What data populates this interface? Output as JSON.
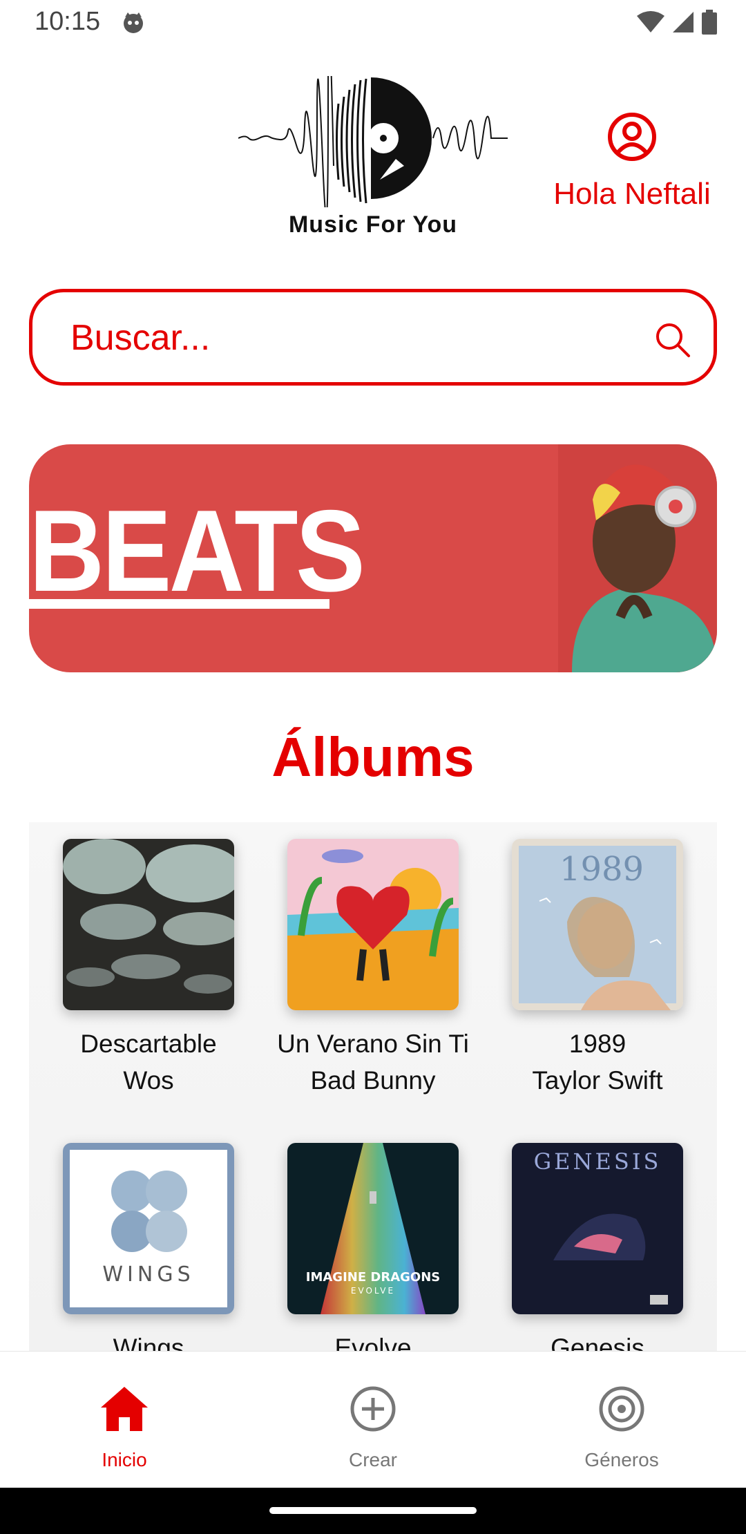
{
  "status_bar": {
    "time": "10:15"
  },
  "header": {
    "logo_text": "Music For You",
    "greeting": "Hola Neftali"
  },
  "search": {
    "placeholder": "Buscar..."
  },
  "banner": {
    "text": "BEATS"
  },
  "section": {
    "title": "Álbums"
  },
  "albums": [
    {
      "title": "Descartable",
      "artist": "Wos"
    },
    {
      "title": "Un Verano Sin Ti",
      "artist": "Bad Bunny"
    },
    {
      "title": "1989",
      "artist": "Taylor Swift"
    },
    {
      "title": "Wings",
      "artist": ""
    },
    {
      "title": "Evolve",
      "artist": ""
    },
    {
      "title": "Genesis",
      "artist": ""
    }
  ],
  "album_cover_text": {
    "wings": "WINGS",
    "evolve_band": "IMAGINE DRAGONS",
    "evolve_title": "EVOLVE",
    "genesis": "GENESIS",
    "taylor": "1989"
  },
  "nav": {
    "items": [
      {
        "label": "Inicio",
        "icon": "home-icon",
        "active": true
      },
      {
        "label": "Crear",
        "icon": "add-circle-icon",
        "active": false
      },
      {
        "label": "Géneros",
        "icon": "target-icon",
        "active": false
      }
    ]
  },
  "colors": {
    "accent": "#e40000",
    "banner": "#d94a48",
    "nav_inactive": "#777777"
  }
}
